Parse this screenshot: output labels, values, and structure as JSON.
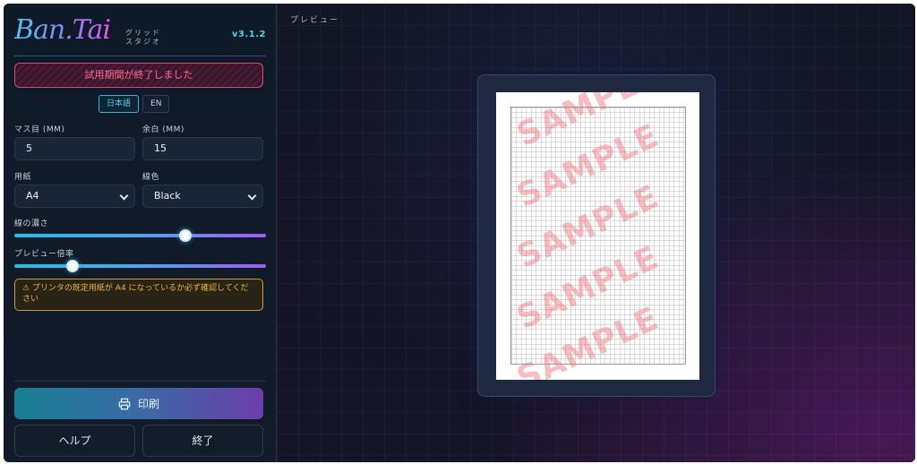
{
  "brand": {
    "logo": "Ban.Tai",
    "subtitle": "グリッド スタジオ",
    "version": "v3.1.2"
  },
  "trial_banner": "試用期間が終了しました",
  "language": {
    "options": [
      "日本語",
      "EN"
    ],
    "selected": "日本語"
  },
  "settings": {
    "grid_size": {
      "label": "マス目 (MM)",
      "value": "5"
    },
    "margin": {
      "label": "余白 (MM)",
      "value": "15"
    },
    "paper": {
      "label": "用紙",
      "value": "A4"
    },
    "line_color": {
      "label": "線色",
      "value": "Black"
    },
    "line_darkness": {
      "label": "線の濃さ",
      "level": 0.68
    },
    "preview_zoom": {
      "label": "プレビュー倍率",
      "level": 0.23
    }
  },
  "warning": {
    "icon": "warning-icon",
    "text": "⚠ プリンタの既定用紙が A4 になっているか必ず確認してください"
  },
  "actions": {
    "print": "印刷",
    "help": "ヘルプ",
    "exit": "終了"
  },
  "preview": {
    "label": "プレビュー",
    "watermark": "SAMPLE"
  },
  "colors": {
    "accent_cyan": "#4cd3e8",
    "accent_purple": "#a25af0",
    "danger_pink": "#ff6b9a",
    "warning_amber": "#f0b23c"
  }
}
